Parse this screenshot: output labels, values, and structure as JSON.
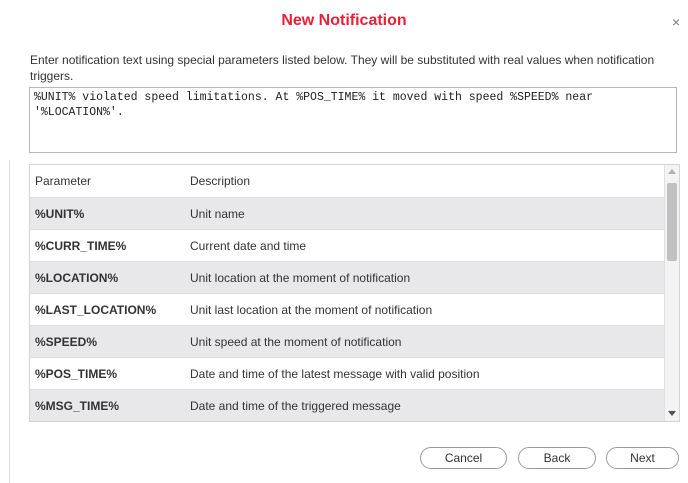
{
  "dialog": {
    "title": "New Notification",
    "close_glyph": "×",
    "instructions": "Enter notification text using special parameters listed below. They will be substituted with real values when notification triggers.",
    "template_text": "%UNIT% violated speed limitations. At %POS_TIME% it moved with speed %SPEED% near '%LOCATION%'.",
    "title_color": "#e8203a"
  },
  "table": {
    "headers": {
      "parameter": "Parameter",
      "description": "Description"
    },
    "rows": [
      {
        "param": "%UNIT%",
        "desc": "Unit name"
      },
      {
        "param": "%CURR_TIME%",
        "desc": "Current date and time"
      },
      {
        "param": "%LOCATION%",
        "desc": "Unit location at the moment of notification"
      },
      {
        "param": "%LAST_LOCATION%",
        "desc": "Unit last location at the moment of notification"
      },
      {
        "param": "%SPEED%",
        "desc": "Unit speed at the moment of notification"
      },
      {
        "param": "%POS_TIME%",
        "desc": "Date and time of the latest message with valid position"
      },
      {
        "param": "%MSG_TIME%",
        "desc": "Date and time of the triggered message"
      }
    ]
  },
  "buttons": {
    "cancel": "Cancel",
    "back": "Back",
    "next": "Next"
  }
}
